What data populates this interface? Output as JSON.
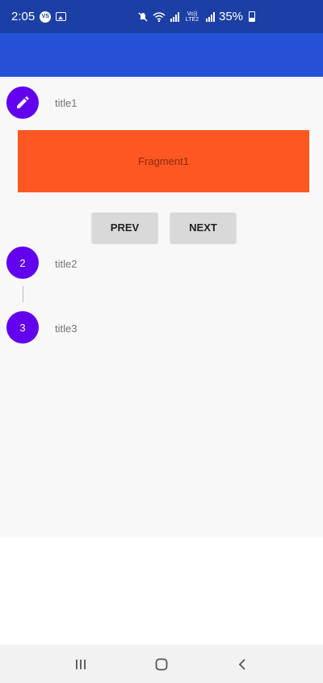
{
  "status_bar": {
    "time": "2:05",
    "notification_badge": "VS",
    "battery_text": "35%",
    "network_label": "Vo)) LTE2"
  },
  "stepper": {
    "steps": [
      {
        "indicator_icon": "edit-pencil-icon",
        "title": "title1",
        "state": "active"
      },
      {
        "number": "2",
        "title": "title2",
        "state": "inactive"
      },
      {
        "number": "3",
        "title": "title3",
        "state": "inactive"
      }
    ],
    "fragment_label": "Fragment1",
    "prev_label": "PREV",
    "next_label": "NEXT"
  },
  "colors": {
    "status_bar": "#1c3fa6",
    "app_bar": "#2451d6",
    "step_circle": "#6200ee",
    "fragment_bg": "#ff5722",
    "button_bg": "#d9d9d9"
  },
  "nav_bar": {
    "items": [
      "recents-icon",
      "home-icon",
      "back-icon"
    ]
  }
}
